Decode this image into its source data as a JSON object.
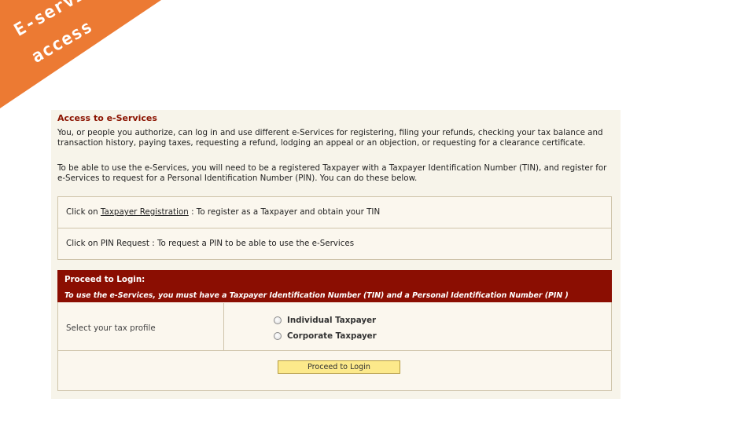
{
  "banner": {
    "line1": "E-service",
    "line2": "access",
    "color": "#ec7a33"
  },
  "panel": {
    "title": "Access to e-Services",
    "paragraph1": "You, or people you authorize, can log in and use different e-Services for registering, filing your refunds, checking your tax balance and transaction history, paying taxes, requesting a refund, lodging an appeal or an objection, or requesting for a clearance certificate.",
    "paragraph2": "To be able to use the e-Services, you will need to be a registered Taxpayer with a Taxpayer Identification Number (TIN), and register for e-Services to request for a Personal Identification Number (PIN). You can do these below.",
    "registration_row": {
      "prefix": "Click on ",
      "link": "Taxpayer Registration",
      "suffix": " : To register as a Taxpayer and obtain your TIN"
    },
    "pin_row": {
      "text": "Click on PIN Request : To request a PIN to be able to use the e-Services"
    },
    "login": {
      "title": "Proceed to Login:",
      "subtitle": "To use the e-Services, you must have a Taxpayer Identification Number (TIN) and a Personal Identification Number (PIN )",
      "profile_label": "Select your tax profile",
      "options": [
        "Individual Taxpayer",
        "Corporate Taxpayer"
      ],
      "button": "Proceed to Login"
    }
  }
}
